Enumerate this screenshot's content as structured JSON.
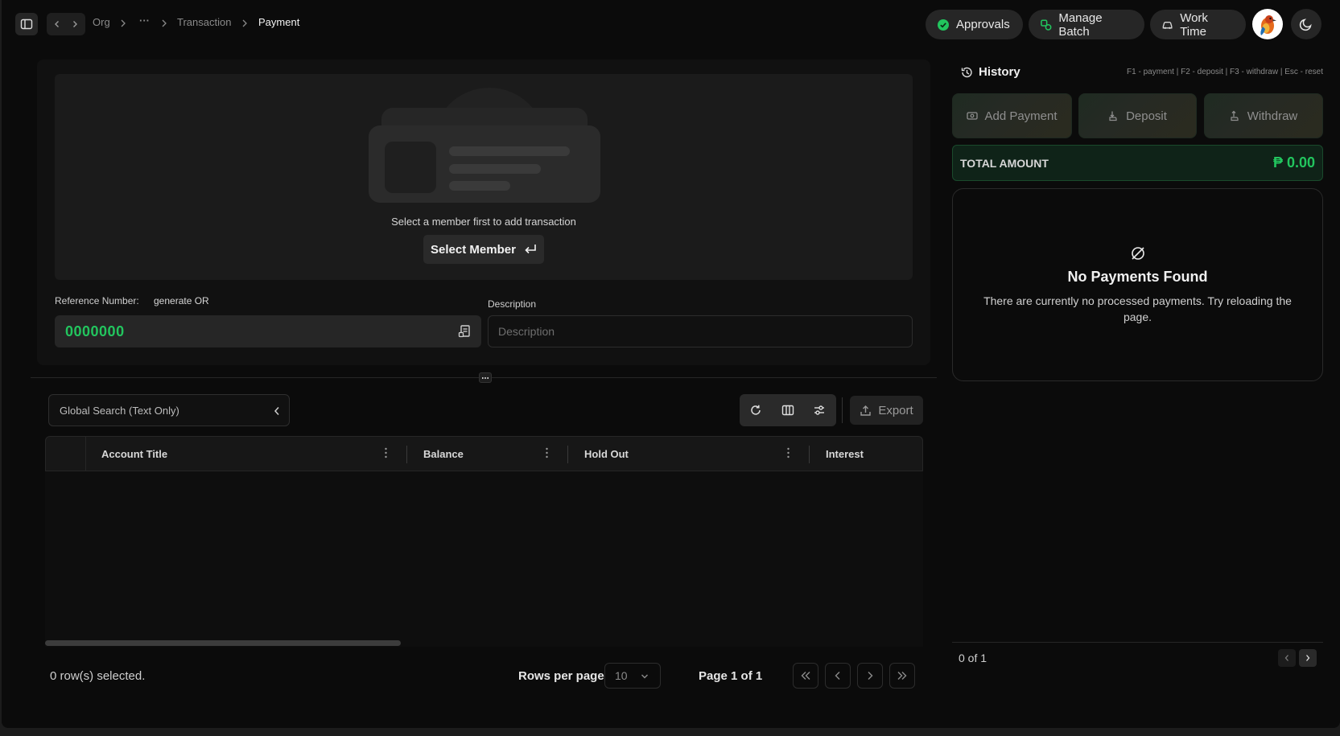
{
  "nav": {
    "breadcrumbs": [
      "Org",
      "···",
      "Transaction",
      "Payment"
    ]
  },
  "header": {
    "approvals_label": "Approvals",
    "manage_batch_label": "Manage Batch",
    "work_time_label": "Work Time"
  },
  "member": {
    "prompt": "Select a member first to add transaction",
    "select_label": "Select Member"
  },
  "reference": {
    "label": "Reference Number:",
    "generate_label": "generate OR",
    "value": "0000000"
  },
  "description": {
    "label": "Description",
    "placeholder": "Description"
  },
  "table": {
    "search_placeholder": "Global Search (Text Only)",
    "export_label": "Export",
    "columns": [
      "Account Title",
      "Balance",
      "Hold Out",
      "Interest"
    ],
    "rows": [],
    "selected_text": "0 row(s) selected.",
    "rows_per_page_label": "Rows per page",
    "rows_per_page_value": "10",
    "page_text": "Page 1 of 1"
  },
  "history": {
    "title": "History",
    "shortcuts": "F1 - payment | F2 - deposit | F3 - withdraw | Esc - reset",
    "actions": [
      "Add Payment",
      "Deposit",
      "Withdraw"
    ],
    "total_label": "TOTAL AMOUNT",
    "total_value": "₱ 0.00",
    "empty_title": "No Payments Found",
    "empty_text": "There are currently no processed payments. Try reloading the page.",
    "pagination_text": "0 of 1"
  },
  "colors": {
    "accent_green": "#22c55e",
    "background": "#0b0b0b",
    "panel": "#1b1b1b"
  }
}
